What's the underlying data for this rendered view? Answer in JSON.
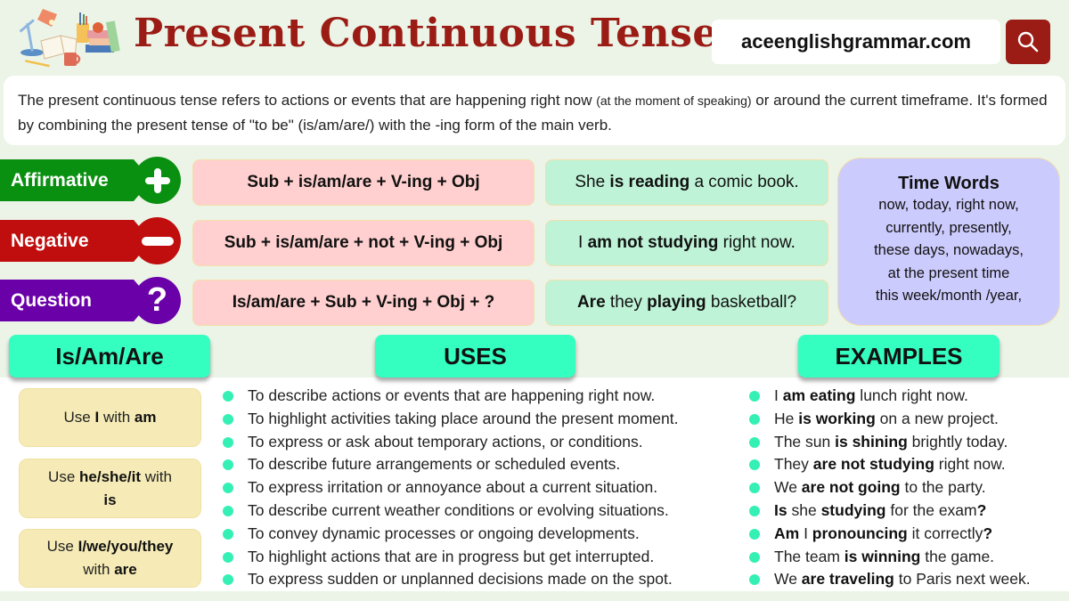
{
  "header": {
    "title": "Present Continuous Tense",
    "site": "aceenglishgrammar.com",
    "search_icon": "search-icon",
    "illustration": "books-lamp-illustration"
  },
  "intro": {
    "part1": "The present continuous tense refers to actions or events that are happening right now ",
    "part_small": "(at the moment of speaking)",
    "part2": " or around the current timeframe. It's formed by combining the present tense of \"to be\" (is/am/are/) with the -ing form of the main verb."
  },
  "structures": [
    {
      "label": "Affirmative",
      "icon": "plus-icon",
      "color": "#0a9010",
      "formula": "Sub + is/am/are + V-ing + Obj",
      "example": [
        {
          "t": "She ",
          "b": false
        },
        {
          "t": "is reading",
          "b": true
        },
        {
          "t": " a comic book.",
          "b": false
        }
      ]
    },
    {
      "label": "Negative",
      "icon": "minus-icon",
      "color": "#c00d0d",
      "formula": "Sub + is/am/are + not + V-ing + Obj",
      "example": [
        {
          "t": "I ",
          "b": false
        },
        {
          "t": "am not studying",
          "b": true
        },
        {
          "t": " right now.",
          "b": false
        }
      ]
    },
    {
      "label": "Question",
      "icon": "question-mark-icon",
      "color": "#6a00a8",
      "formula": "Is/am/are + Sub + V-ing + Obj + ?",
      "example": [
        {
          "t": "Are",
          "b": true
        },
        {
          "t": " they ",
          "b": false
        },
        {
          "t": "playing",
          "b": true
        },
        {
          "t": " basketball?",
          "b": false
        }
      ]
    }
  ],
  "time_words": {
    "title": "Time Words",
    "lines": [
      "now, today, right now,",
      "currently, presently,",
      "these days, nowadays,",
      "at the present time",
      "this week/month /year,"
    ]
  },
  "sections": {
    "is_am_are": "Is/Am/Are",
    "uses": "USES",
    "examples": "EXAMPLES"
  },
  "rules": [
    [
      {
        "t": "Use ",
        "b": false
      },
      {
        "t": "I",
        "b": true
      },
      {
        "t": " with ",
        "b": false
      },
      {
        "t": "am",
        "b": true
      }
    ],
    [
      {
        "t": "Use ",
        "b": false
      },
      {
        "t": "he/she/it",
        "b": true
      },
      {
        "t": " with",
        "b": false
      },
      {
        "t": "\n",
        "b": false
      },
      {
        "t": "is",
        "b": true
      }
    ],
    [
      {
        "t": "Use ",
        "b": false
      },
      {
        "t": "I/we/you/they",
        "b": true
      },
      {
        "t": "\n",
        "b": false
      },
      {
        "t": "with ",
        "b": false
      },
      {
        "t": "are",
        "b": true
      }
    ]
  ],
  "uses": [
    "To describe actions or events that are happening right now.",
    "To highlight activities taking place around the present moment.",
    "To express or ask about temporary actions, or conditions.",
    "To describe future arrangements or scheduled events.",
    "To express irritation or annoyance about a current situation.",
    "To describe current weather conditions or evolving situations.",
    "To convey dynamic processes or ongoing developments.",
    "To highlight actions that are in progress but get interrupted.",
    "To express sudden or unplanned decisions made on the spot."
  ],
  "examples": [
    [
      {
        "t": "I ",
        "b": false
      },
      {
        "t": "am eating",
        "b": true
      },
      {
        "t": " lunch right now.",
        "b": false
      }
    ],
    [
      {
        "t": "He ",
        "b": false
      },
      {
        "t": "is working",
        "b": true
      },
      {
        "t": " on a new project.",
        "b": false
      }
    ],
    [
      {
        "t": "The sun ",
        "b": false
      },
      {
        "t": "is shining",
        "b": true
      },
      {
        "t": " brightly today.",
        "b": false
      }
    ],
    [
      {
        "t": "They ",
        "b": false
      },
      {
        "t": "are not studying",
        "b": true
      },
      {
        "t": " right now.",
        "b": false
      }
    ],
    [
      {
        "t": "We ",
        "b": false
      },
      {
        "t": "are not going",
        "b": true
      },
      {
        "t": " to the party.",
        "b": false
      }
    ],
    [
      {
        "t": "Is",
        "b": true
      },
      {
        "t": " she ",
        "b": false
      },
      {
        "t": "studying",
        "b": true
      },
      {
        "t": " for the exam",
        "b": false
      },
      {
        "t": "?",
        "b": true
      }
    ],
    [
      {
        "t": "Am",
        "b": true
      },
      {
        "t": " I ",
        "b": false
      },
      {
        "t": "pronouncing",
        "b": true
      },
      {
        "t": " it correctly",
        "b": false
      },
      {
        "t": "?",
        "b": true
      }
    ],
    [
      {
        "t": "The team ",
        "b": false
      },
      {
        "t": "is winning",
        "b": true
      },
      {
        "t": " the game.",
        "b": false
      }
    ],
    [
      {
        "t": "We ",
        "b": false
      },
      {
        "t": "are traveling",
        "b": true
      },
      {
        "t": " to Paris next week.",
        "b": false
      }
    ]
  ],
  "colors": {
    "title": "#9b1b15",
    "header_pill": "#34ffc0",
    "formula_bg": "#ffd0cf",
    "example_bg": "#bff3d7",
    "time_words_bg": "#cccbfd",
    "rule_bg": "#f6ebb6",
    "bullet": "#34f0b4"
  }
}
